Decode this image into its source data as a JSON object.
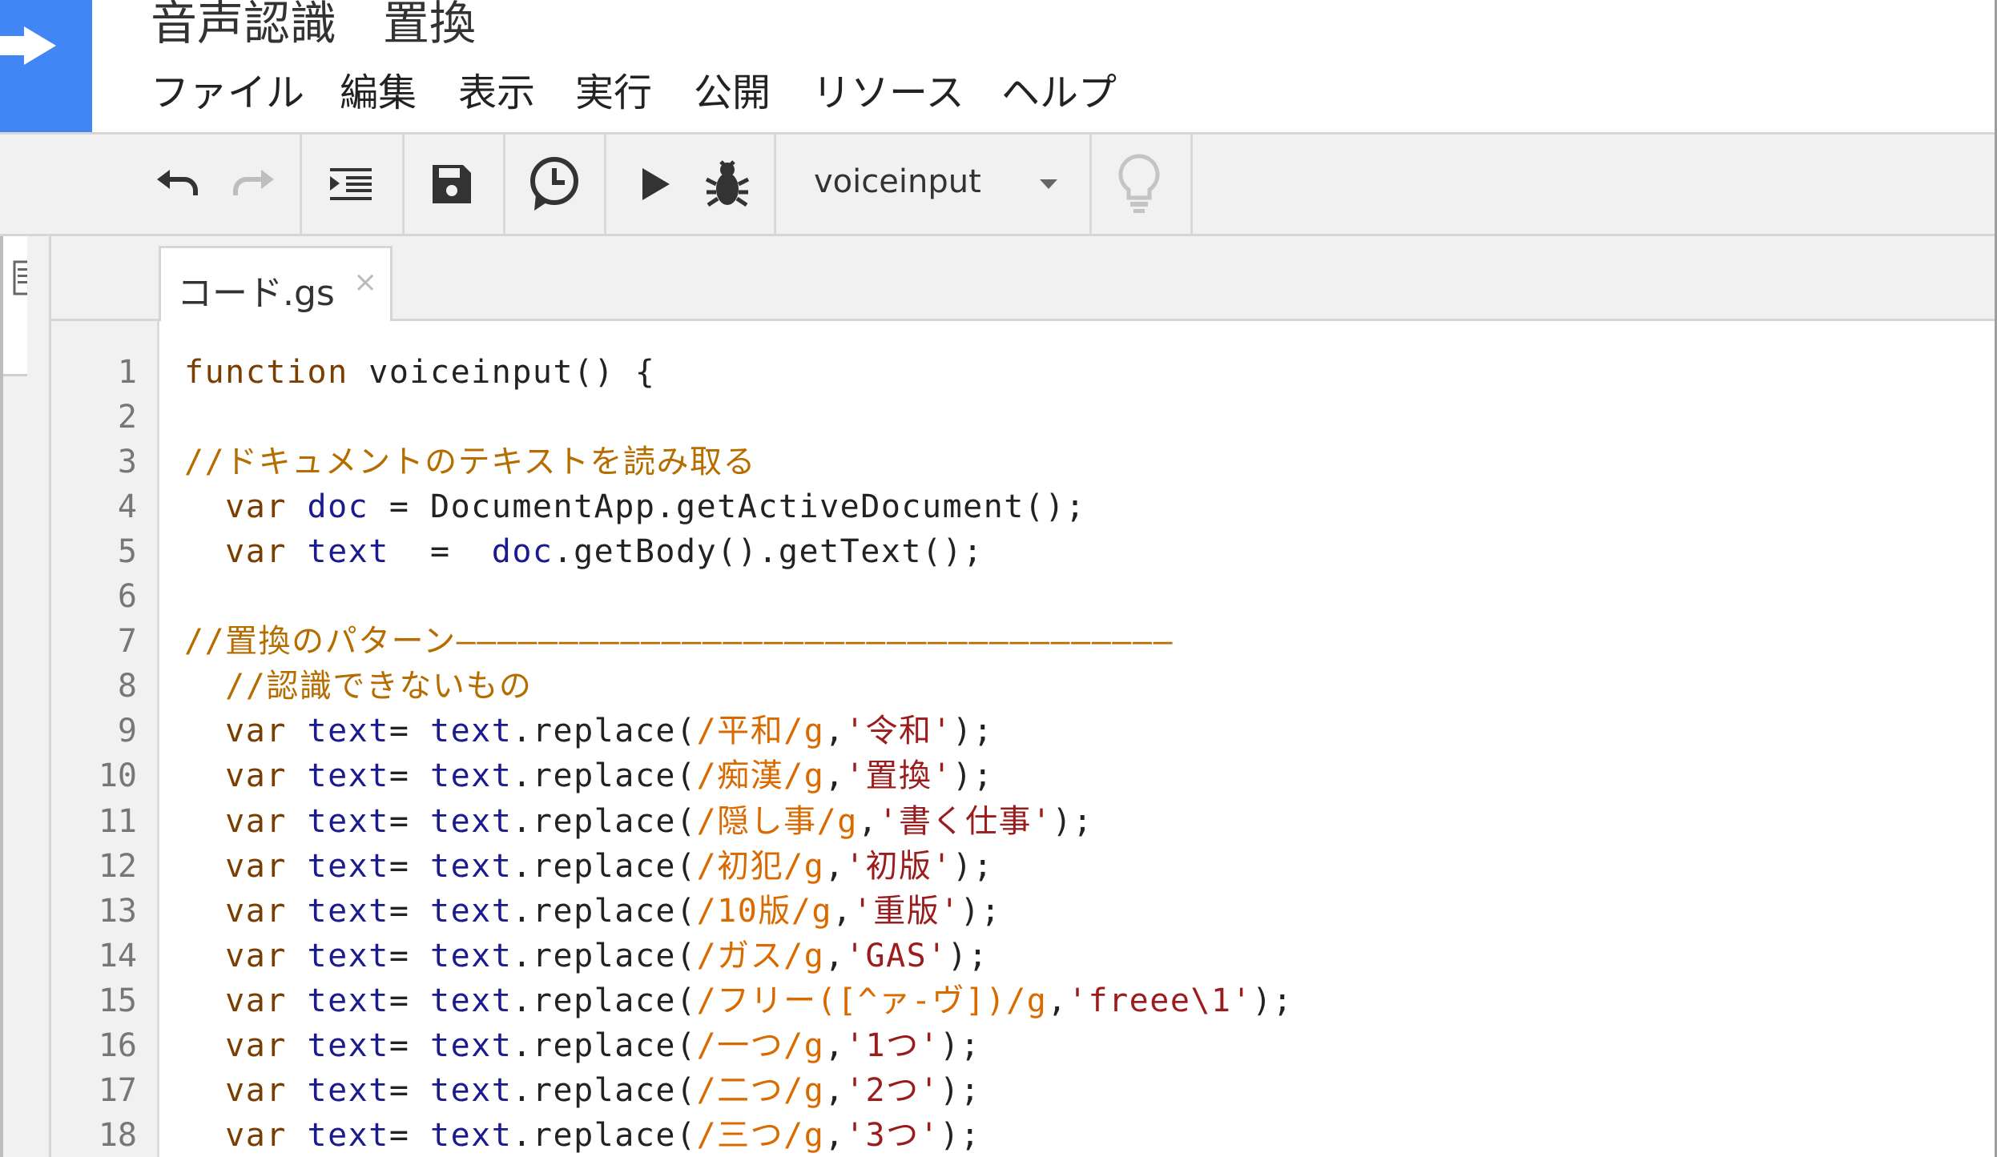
{
  "app": {
    "title": "音声認識　置換",
    "logo_color": "#4285f4"
  },
  "menu": {
    "items": [
      "ファイル",
      "編集",
      "表示",
      "実行",
      "公開",
      "リソース",
      "ヘルプ"
    ]
  },
  "toolbar": {
    "icons": {
      "undo": "undo-icon",
      "redo": "redo-icon",
      "indent": "indent-icon",
      "save": "save-icon",
      "triggers": "clock-icon",
      "run": "play-icon",
      "debug": "bug-icon",
      "tip": "lightbulb-icon"
    },
    "function_select": "voiceinput"
  },
  "tabs": [
    {
      "label": "コード.gs",
      "close": "×"
    }
  ],
  "editor": {
    "line_numbers": [
      "1",
      "2",
      "3",
      "4",
      "5",
      "6",
      "7",
      "8",
      "9",
      "10",
      "11",
      "12",
      "13",
      "14",
      "15",
      "16",
      "17",
      "18"
    ],
    "lines": [
      [
        {
          "t": "k",
          "x": "function"
        },
        {
          "t": "p",
          "x": " voiceinput() {"
        }
      ],
      [],
      [
        {
          "t": "c",
          "x": "//ドキュメントのテキストを読み取る"
        }
      ],
      [
        {
          "t": "p",
          "x": "  "
        },
        {
          "t": "k",
          "x": "var"
        },
        {
          "t": "p",
          "x": " "
        },
        {
          "t": "v",
          "x": "doc"
        },
        {
          "t": "p",
          "x": " = DocumentApp.getActiveDocument();"
        }
      ],
      [
        {
          "t": "p",
          "x": "  "
        },
        {
          "t": "k",
          "x": "var"
        },
        {
          "t": "p",
          "x": " "
        },
        {
          "t": "v",
          "x": "text"
        },
        {
          "t": "p",
          "x": "  =  "
        },
        {
          "t": "v",
          "x": "doc"
        },
        {
          "t": "p",
          "x": ".getBody().getText();"
        }
      ],
      [],
      [
        {
          "t": "c",
          "x": "//置換のパターン———————————————————————————————————"
        }
      ],
      [
        {
          "t": "c",
          "x": "  //認識できないもの"
        }
      ],
      [
        {
          "t": "p",
          "x": "  "
        },
        {
          "t": "k",
          "x": "var"
        },
        {
          "t": "p",
          "x": " "
        },
        {
          "t": "v",
          "x": "text"
        },
        {
          "t": "p",
          "x": "= "
        },
        {
          "t": "v",
          "x": "text"
        },
        {
          "t": "p",
          "x": ".replace("
        },
        {
          "t": "r",
          "x": "/平和/g"
        },
        {
          "t": "p",
          "x": ","
        },
        {
          "t": "s",
          "x": "'令和'"
        },
        {
          "t": "p",
          "x": ");"
        }
      ],
      [
        {
          "t": "p",
          "x": "  "
        },
        {
          "t": "k",
          "x": "var"
        },
        {
          "t": "p",
          "x": " "
        },
        {
          "t": "v",
          "x": "text"
        },
        {
          "t": "p",
          "x": "= "
        },
        {
          "t": "v",
          "x": "text"
        },
        {
          "t": "p",
          "x": ".replace("
        },
        {
          "t": "r",
          "x": "/痴漢/g"
        },
        {
          "t": "p",
          "x": ","
        },
        {
          "t": "s",
          "x": "'置換'"
        },
        {
          "t": "p",
          "x": ");"
        }
      ],
      [
        {
          "t": "p",
          "x": "  "
        },
        {
          "t": "k",
          "x": "var"
        },
        {
          "t": "p",
          "x": " "
        },
        {
          "t": "v",
          "x": "text"
        },
        {
          "t": "p",
          "x": "= "
        },
        {
          "t": "v",
          "x": "text"
        },
        {
          "t": "p",
          "x": ".replace("
        },
        {
          "t": "r",
          "x": "/隠し事/g"
        },
        {
          "t": "p",
          "x": ","
        },
        {
          "t": "s",
          "x": "'書く仕事'"
        },
        {
          "t": "p",
          "x": ");"
        }
      ],
      [
        {
          "t": "p",
          "x": "  "
        },
        {
          "t": "k",
          "x": "var"
        },
        {
          "t": "p",
          "x": " "
        },
        {
          "t": "v",
          "x": "text"
        },
        {
          "t": "p",
          "x": "= "
        },
        {
          "t": "v",
          "x": "text"
        },
        {
          "t": "p",
          "x": ".replace("
        },
        {
          "t": "r",
          "x": "/初犯/g"
        },
        {
          "t": "p",
          "x": ","
        },
        {
          "t": "s",
          "x": "'初版'"
        },
        {
          "t": "p",
          "x": ");"
        }
      ],
      [
        {
          "t": "p",
          "x": "  "
        },
        {
          "t": "k",
          "x": "var"
        },
        {
          "t": "p",
          "x": " "
        },
        {
          "t": "v",
          "x": "text"
        },
        {
          "t": "p",
          "x": "= "
        },
        {
          "t": "v",
          "x": "text"
        },
        {
          "t": "p",
          "x": ".replace("
        },
        {
          "t": "r",
          "x": "/10版/g"
        },
        {
          "t": "p",
          "x": ","
        },
        {
          "t": "s",
          "x": "'重版'"
        },
        {
          "t": "p",
          "x": ");"
        }
      ],
      [
        {
          "t": "p",
          "x": "  "
        },
        {
          "t": "k",
          "x": "var"
        },
        {
          "t": "p",
          "x": " "
        },
        {
          "t": "v",
          "x": "text"
        },
        {
          "t": "p",
          "x": "= "
        },
        {
          "t": "v",
          "x": "text"
        },
        {
          "t": "p",
          "x": ".replace("
        },
        {
          "t": "r",
          "x": "/ガス/g"
        },
        {
          "t": "p",
          "x": ","
        },
        {
          "t": "s",
          "x": "'GAS'"
        },
        {
          "t": "p",
          "x": ");"
        }
      ],
      [
        {
          "t": "p",
          "x": "  "
        },
        {
          "t": "k",
          "x": "var"
        },
        {
          "t": "p",
          "x": " "
        },
        {
          "t": "v",
          "x": "text"
        },
        {
          "t": "p",
          "x": "= "
        },
        {
          "t": "v",
          "x": "text"
        },
        {
          "t": "p",
          "x": ".replace("
        },
        {
          "t": "r",
          "x": "/フリー([^ァ-ヴ])/g"
        },
        {
          "t": "p",
          "x": ","
        },
        {
          "t": "s",
          "x": "'freee\\1'"
        },
        {
          "t": "p",
          "x": ");"
        }
      ],
      [
        {
          "t": "p",
          "x": "  "
        },
        {
          "t": "k",
          "x": "var"
        },
        {
          "t": "p",
          "x": " "
        },
        {
          "t": "v",
          "x": "text"
        },
        {
          "t": "p",
          "x": "= "
        },
        {
          "t": "v",
          "x": "text"
        },
        {
          "t": "p",
          "x": ".replace("
        },
        {
          "t": "r",
          "x": "/一つ/g"
        },
        {
          "t": "p",
          "x": ","
        },
        {
          "t": "s",
          "x": "'1つ'"
        },
        {
          "t": "p",
          "x": ");"
        }
      ],
      [
        {
          "t": "p",
          "x": "  "
        },
        {
          "t": "k",
          "x": "var"
        },
        {
          "t": "p",
          "x": " "
        },
        {
          "t": "v",
          "x": "text"
        },
        {
          "t": "p",
          "x": "= "
        },
        {
          "t": "v",
          "x": "text"
        },
        {
          "t": "p",
          "x": ".replace("
        },
        {
          "t": "r",
          "x": "/二つ/g"
        },
        {
          "t": "p",
          "x": ","
        },
        {
          "t": "s",
          "x": "'2つ'"
        },
        {
          "t": "p",
          "x": ");"
        }
      ],
      [
        {
          "t": "p",
          "x": "  "
        },
        {
          "t": "k",
          "x": "var"
        },
        {
          "t": "p",
          "x": " "
        },
        {
          "t": "v",
          "x": "text"
        },
        {
          "t": "p",
          "x": "= "
        },
        {
          "t": "v",
          "x": "text"
        },
        {
          "t": "p",
          "x": ".replace("
        },
        {
          "t": "r",
          "x": "/三つ/g"
        },
        {
          "t": "p",
          "x": ","
        },
        {
          "t": "s",
          "x": "'3つ'"
        },
        {
          "t": "p",
          "x": ");"
        }
      ]
    ]
  },
  "colors": {
    "keyword": "#7a3e00",
    "variable": "#1b1b8e",
    "comment": "#b56d00",
    "regex": "#d96a00",
    "string": "#9b1c1c"
  }
}
